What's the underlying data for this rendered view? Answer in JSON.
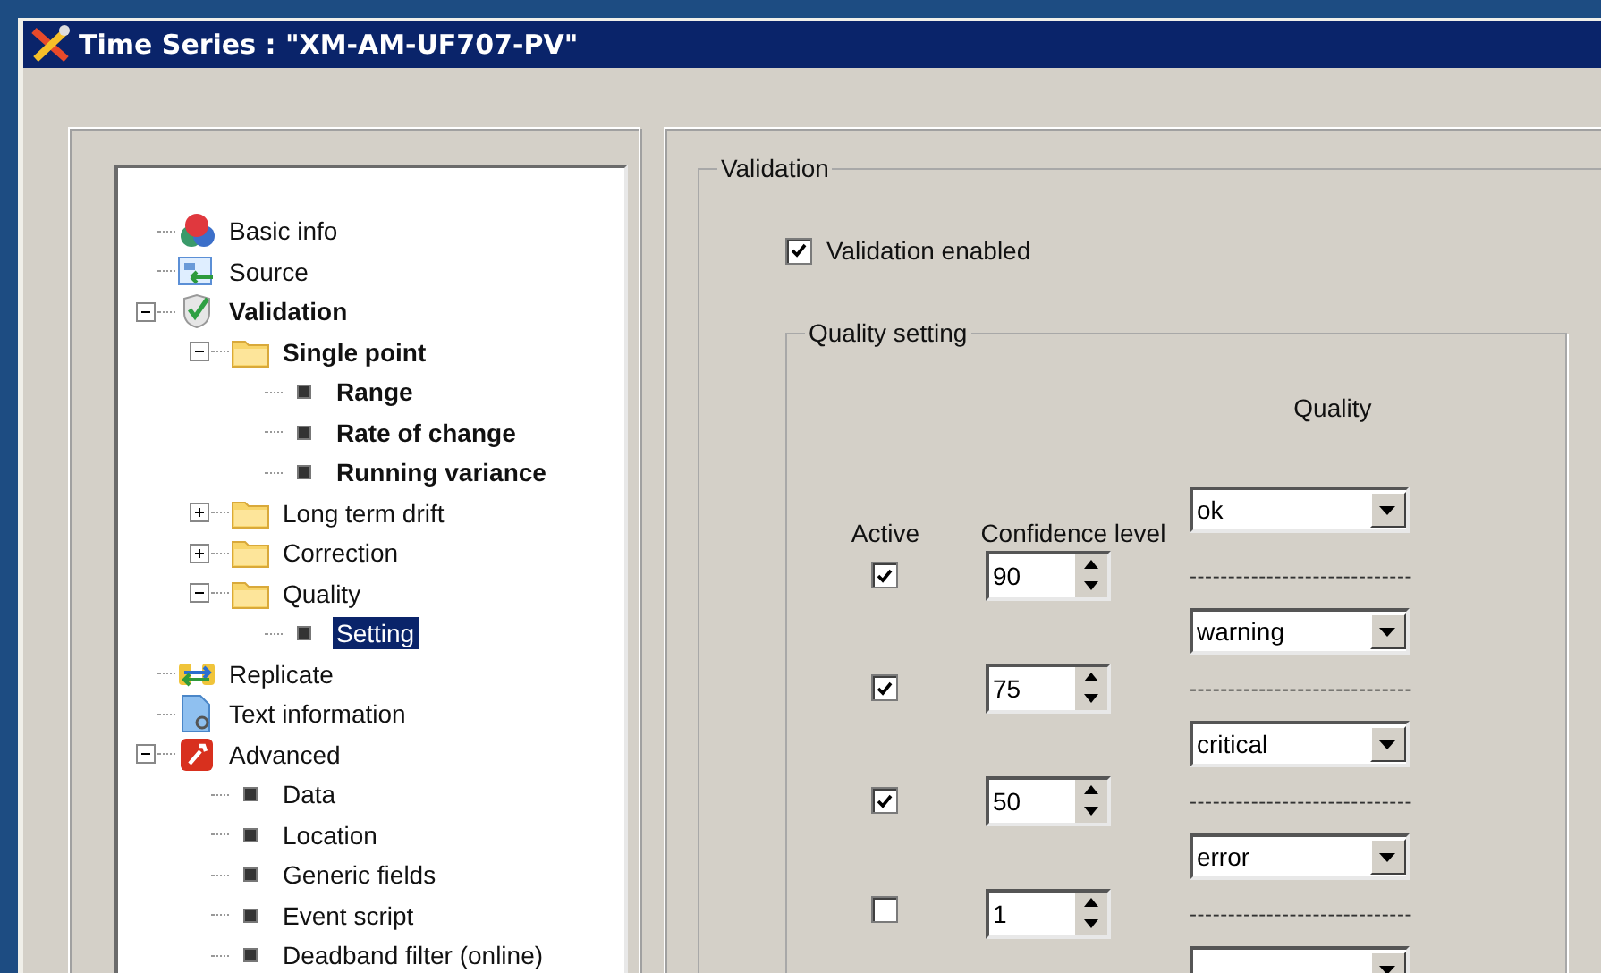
{
  "window": {
    "title": "Time Series : \"XM-AM-UF707-PV\""
  },
  "tree": [
    {
      "label": "Basic info",
      "kind": "cubes",
      "bold": false,
      "selected": false
    },
    {
      "label": "Source",
      "kind": "source",
      "bold": false,
      "selected": false
    },
    {
      "label": "Validation",
      "kind": "shield",
      "bold": true,
      "selected": false,
      "expanded": true,
      "children": [
        {
          "label": "Single point",
          "kind": "folder",
          "bold": true,
          "selected": false,
          "expanded": true,
          "children": [
            {
              "label": "Range",
              "kind": "bullet",
              "bold": true,
              "selected": false
            },
            {
              "label": "Rate of change",
              "kind": "bullet",
              "bold": true,
              "selected": false
            },
            {
              "label": "Running variance",
              "kind": "bullet",
              "bold": true,
              "selected": false
            }
          ]
        },
        {
          "label": "Long term drift",
          "kind": "folder",
          "bold": false,
          "selected": false,
          "expanded": false
        },
        {
          "label": "Correction",
          "kind": "folder",
          "bold": false,
          "selected": false,
          "expanded": false
        },
        {
          "label": "Quality",
          "kind": "folder",
          "bold": false,
          "selected": false,
          "expanded": true,
          "children": [
            {
              "label": "Setting",
              "kind": "bullet",
              "bold": false,
              "selected": true
            }
          ]
        }
      ]
    },
    {
      "label": "Replicate",
      "kind": "replicate",
      "bold": false,
      "selected": false
    },
    {
      "label": "Text information",
      "kind": "document",
      "bold": false,
      "selected": false
    },
    {
      "label": "Advanced",
      "kind": "tools",
      "bold": false,
      "selected": false,
      "expanded": true,
      "children": [
        {
          "label": "Data",
          "kind": "bullet",
          "bold": false,
          "selected": false
        },
        {
          "label": "Location",
          "kind": "bullet",
          "bold": false,
          "selected": false
        },
        {
          "label": "Generic fields",
          "kind": "bullet",
          "bold": false,
          "selected": false
        },
        {
          "label": "Event script",
          "kind": "bullet",
          "bold": false,
          "selected": false
        },
        {
          "label": "Deadband filter (online)",
          "kind": "bullet",
          "bold": false,
          "selected": false
        }
      ]
    }
  ],
  "validation": {
    "legend": "Validation",
    "enabled": {
      "label": "Validation enabled",
      "checked": true
    },
    "quality_setting": {
      "legend": "Quality setting",
      "headers": {
        "active": "Active",
        "confidence": "Confidence level",
        "quality": "Quality"
      },
      "qualities": [
        {
          "value": "ok"
        },
        {
          "value": "warning"
        },
        {
          "value": "critical"
        },
        {
          "value": "error"
        }
      ],
      "thresholds": [
        {
          "active": true,
          "value": "90"
        },
        {
          "active": true,
          "value": "75"
        },
        {
          "active": true,
          "value": "50"
        },
        {
          "active": false,
          "value": "1"
        }
      ],
      "separator": "-----------------------------"
    }
  }
}
